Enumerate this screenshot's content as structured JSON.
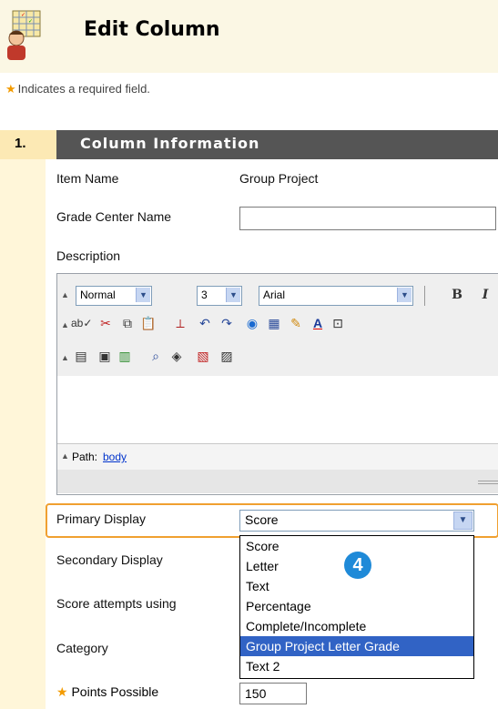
{
  "header": {
    "title": "Edit Column",
    "icon": "gradebook-icon"
  },
  "required_note": {
    "star": "★",
    "text": "Indicates a required field."
  },
  "section": {
    "number": "1.",
    "title": "Column Information"
  },
  "fields": {
    "item_name_label": "Item Name",
    "item_name_value": "Group Project",
    "grade_center_name_label": "Grade Center Name",
    "grade_center_name_value": "",
    "description_label": "Description",
    "primary_display_label": "Primary Display",
    "primary_display_value": "Score",
    "secondary_display_label": "Secondary Display",
    "score_attempts_label": "Score attempts using",
    "category_label": "Category",
    "points_possible_label": "Points Possible",
    "points_possible_value": "150"
  },
  "editor": {
    "format_select": "Normal",
    "size_select": "3",
    "font_select": "Arial",
    "bold": "B",
    "italic": "I",
    "path_label": "Path:",
    "path_link": "body"
  },
  "dropdown": {
    "options": [
      "Score",
      "Letter",
      "Text",
      "Percentage",
      "Complete/Incomplete",
      "Group Project Letter Grade",
      "Text 2"
    ],
    "highlighted": "Group Project Letter Grade"
  },
  "callout": {
    "number": "4"
  },
  "colors": {
    "header_bg": "#fbf7e4",
    "section_bar": "#555555",
    "highlight_border": "#f0a030",
    "selected_option": "#3163c5",
    "badge": "#1f8ad8",
    "required_star": "#f39b00"
  }
}
